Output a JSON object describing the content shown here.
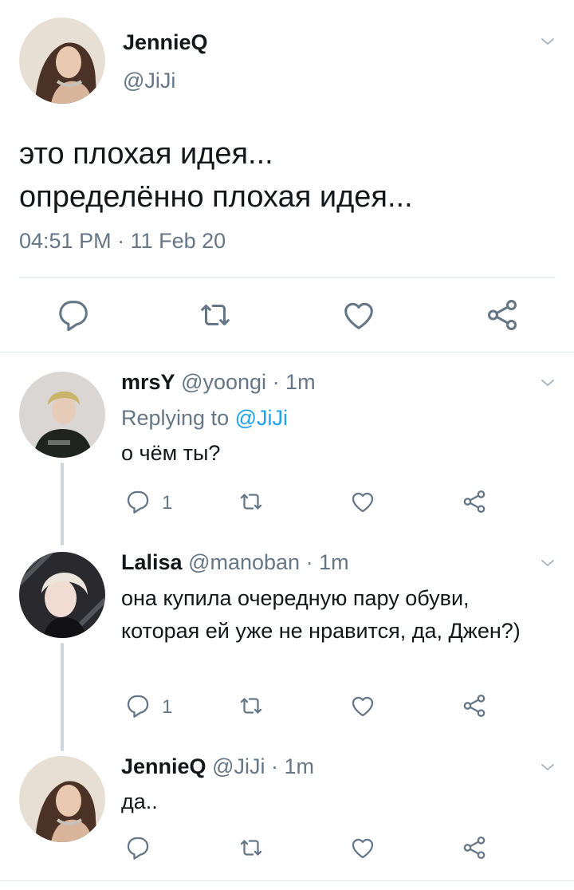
{
  "main_tweet": {
    "display_name": "JennieQ",
    "handle": "@JiJi",
    "text": "это плохая идея...\nопределённо плохая идея...",
    "timestamp": "04:51 PM · 11 Feb 20",
    "actions": [
      "reply-icon",
      "retweet-icon",
      "like-icon",
      "share-icon"
    ]
  },
  "replies": [
    {
      "display_name": "mrsY",
      "handle": "@yoongi",
      "time": "· 1m",
      "replying_prefix": "Replying to",
      "replying_to": "@JiJi",
      "text": "о чём ты?",
      "reply_count": "1"
    },
    {
      "display_name": "Lalisa",
      "handle": "@manoban",
      "time": "· 1m",
      "text": "она купила очередную пару обуви, которая ей уже не нравится, да, Джен?)",
      "reply_count": "1"
    },
    {
      "display_name": "JennieQ",
      "handle": "@JiJi",
      "time": "· 1m",
      "text": "да.."
    }
  ],
  "colors": {
    "text": "#14171a",
    "secondary": "#657786",
    "link": "#1da1f2",
    "icon": "#657786",
    "divider": "#e1e8ed"
  }
}
